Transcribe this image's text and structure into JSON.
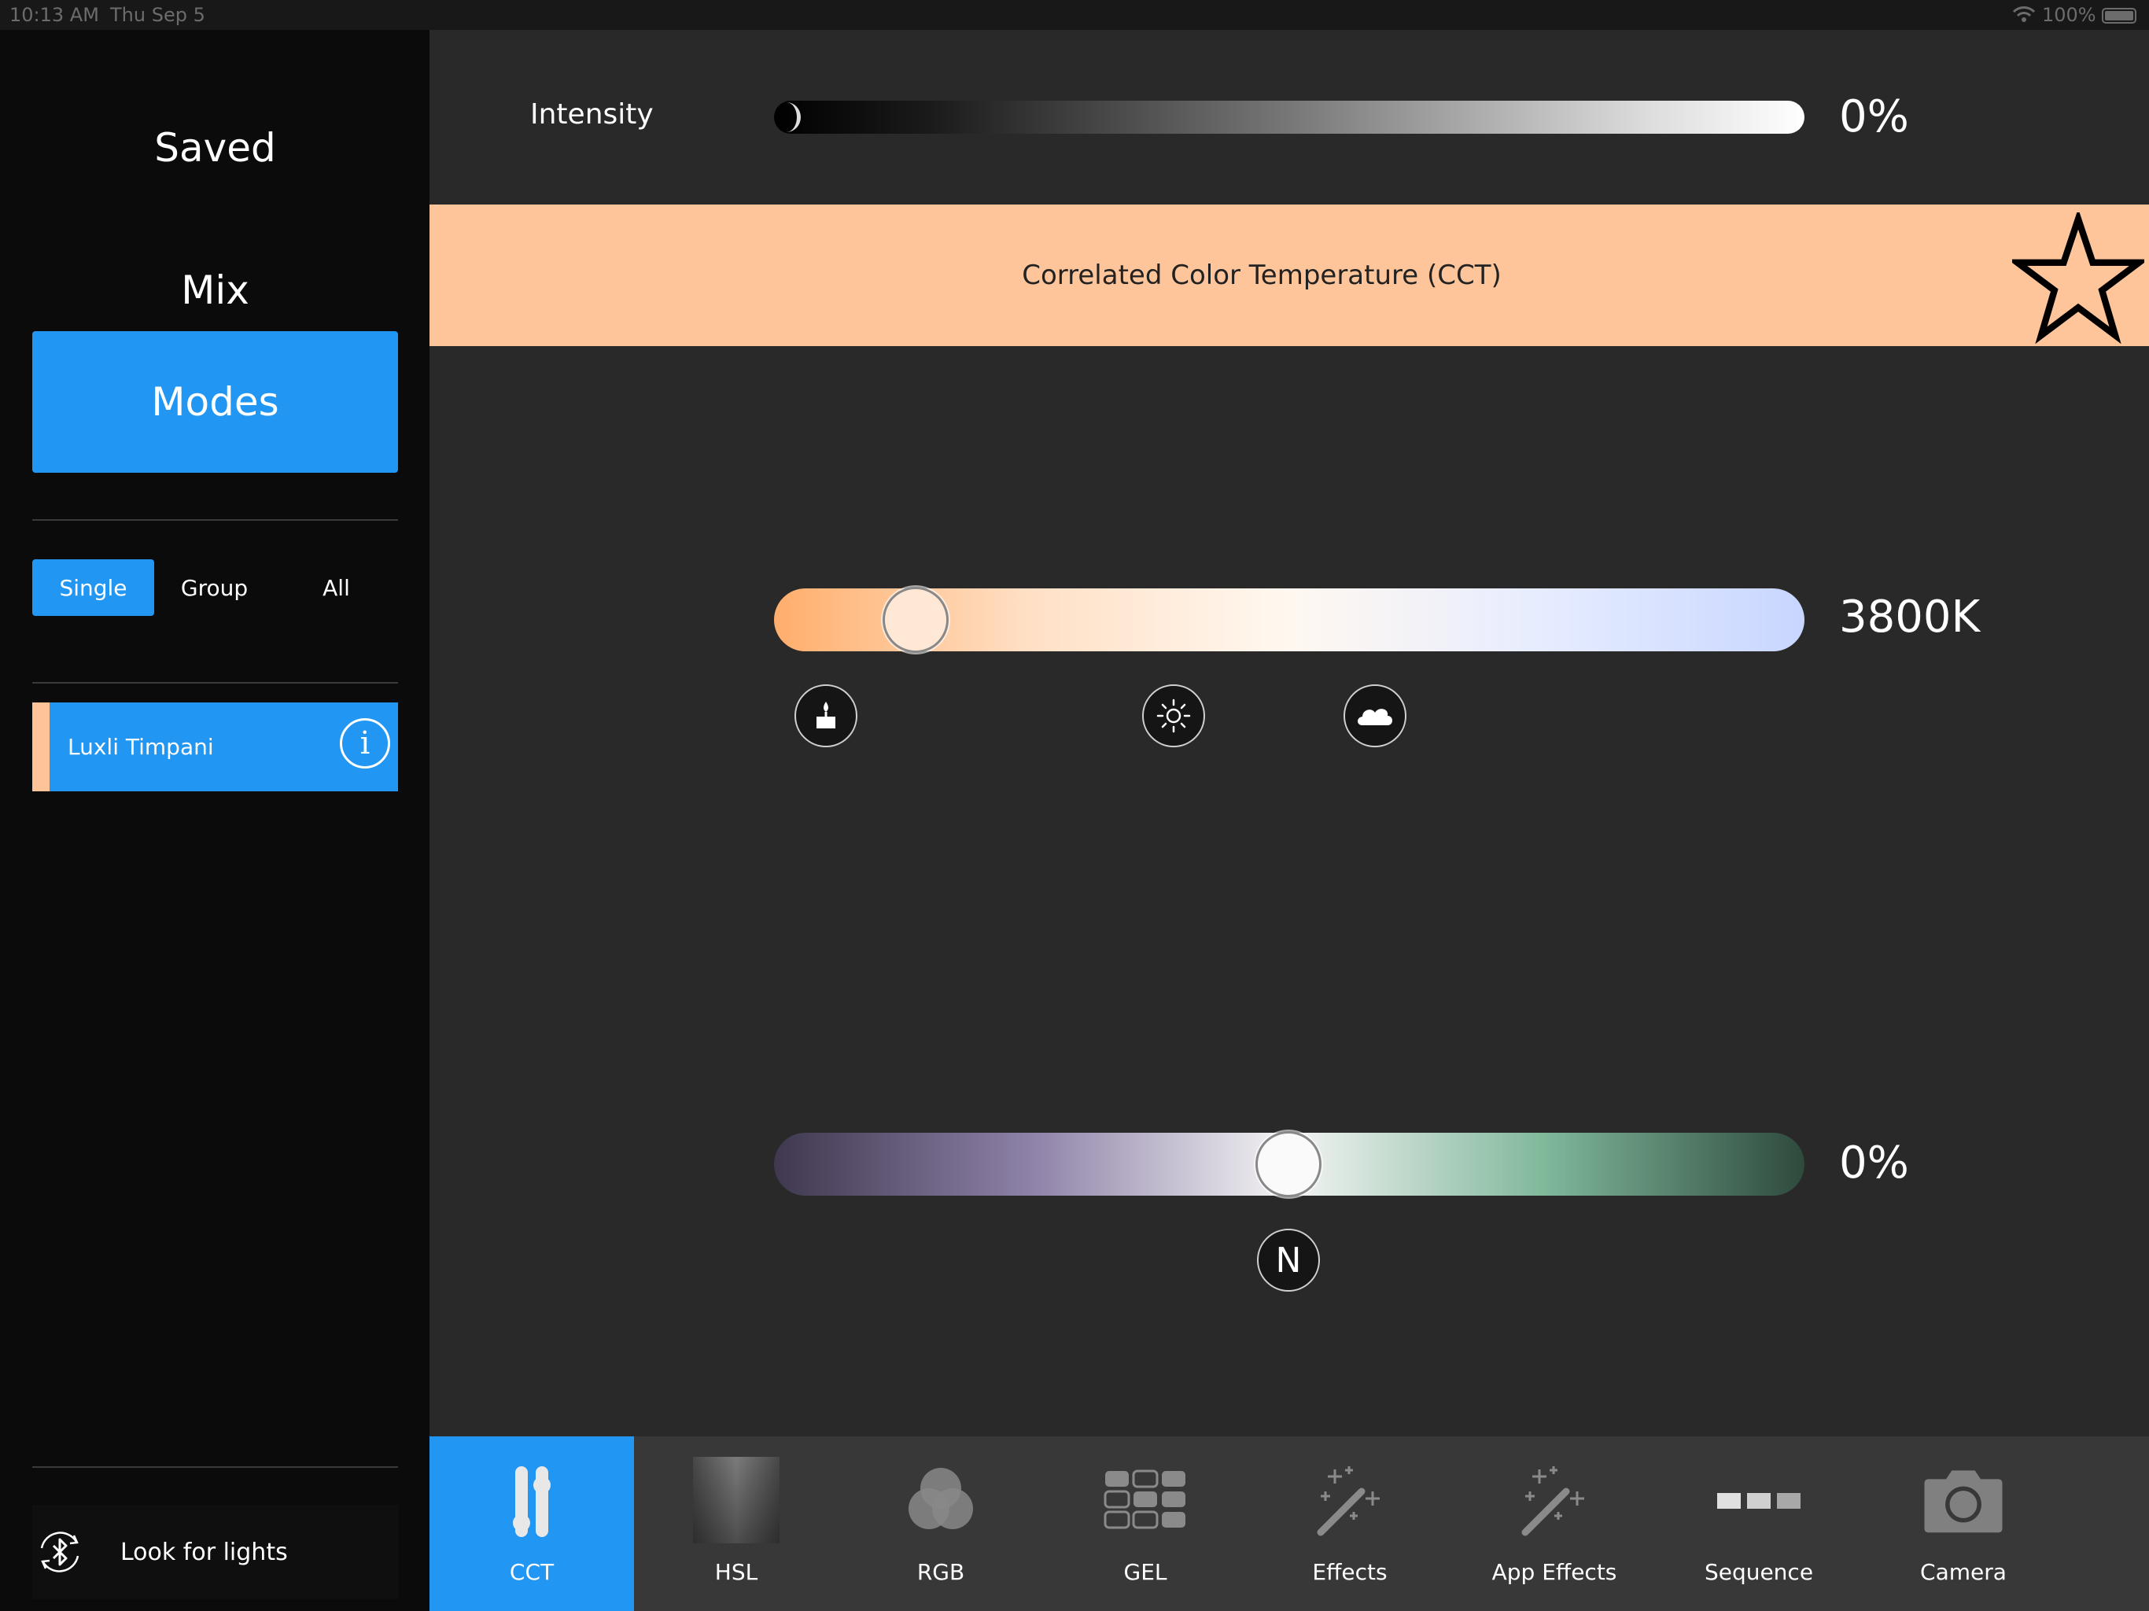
{
  "status_bar": {
    "time": "10:13 AM",
    "date": "Thu Sep 5",
    "battery": "100%"
  },
  "sidebar": {
    "nav": [
      {
        "label": "Saved",
        "active": false
      },
      {
        "label": "Mix",
        "active": false
      },
      {
        "label": "Modes",
        "active": true
      }
    ],
    "segments": [
      {
        "label": "Single",
        "active": true
      },
      {
        "label": "Group",
        "active": false
      },
      {
        "label": "All",
        "active": false
      }
    ],
    "lights": [
      {
        "name": "Luxli Timpani",
        "color": "#ffc39a",
        "info_glyph": "i"
      }
    ],
    "look_for_lights": "Look for lights"
  },
  "main": {
    "intensity": {
      "label": "Intensity",
      "value": "0%",
      "level": 0
    },
    "mode_title": "Correlated Color Temperature (CCT)",
    "mode_color": "#ffc59a",
    "cct": {
      "value": "3800K",
      "presets": [
        "candle-icon",
        "sun-icon",
        "cloud-icon"
      ]
    },
    "tint": {
      "value": "0%",
      "preset_label": "N"
    }
  },
  "toolbar": {
    "tools": [
      {
        "label": "CCT",
        "icon": "cct-sliders-icon",
        "active": true
      },
      {
        "label": "HSL",
        "icon": "hsl-gradient-icon",
        "active": false
      },
      {
        "label": "RGB",
        "icon": "rgb-circles-icon",
        "active": false
      },
      {
        "label": "GEL",
        "icon": "gel-grid-icon",
        "active": false
      },
      {
        "label": "Effects",
        "icon": "magic-wand-icon",
        "active": false
      },
      {
        "label": "App Effects",
        "icon": "magic-wand-icon",
        "active": false
      },
      {
        "label": "Sequence",
        "icon": "sequence-icon",
        "active": false
      },
      {
        "label": "Camera",
        "icon": "camera-icon",
        "active": false
      }
    ]
  },
  "colors": {
    "accent": "#2196f3",
    "sidebar_bg": "#0b0b0b",
    "main_bg": "#292929",
    "toolbar_bg": "#383838"
  }
}
